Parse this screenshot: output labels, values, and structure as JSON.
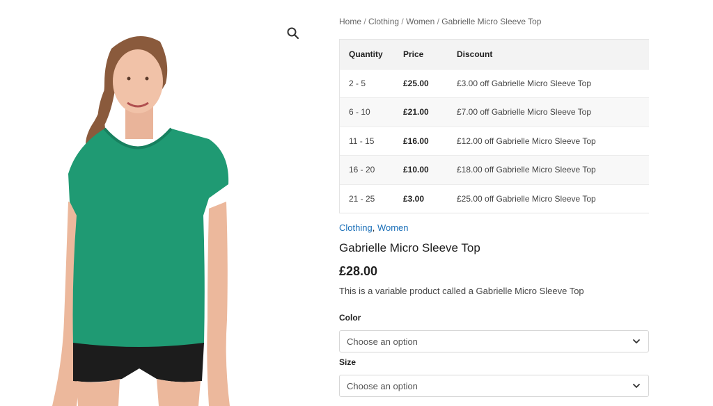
{
  "breadcrumb": {
    "items": [
      "Home",
      "Clothing",
      "Women",
      "Gabrielle Micro Sleeve Top"
    ],
    "separator": "/"
  },
  "discount_table": {
    "headers": [
      "Quantity",
      "Price",
      "Discount"
    ],
    "rows": [
      {
        "qty": "2 - 5",
        "price": "£25.00",
        "discount": "£3.00 off Gabrielle Micro Sleeve Top"
      },
      {
        "qty": "6 - 10",
        "price": "£21.00",
        "discount": "£7.00 off Gabrielle Micro Sleeve Top"
      },
      {
        "qty": "11 - 15",
        "price": "£16.00",
        "discount": "£12.00 off Gabrielle Micro Sleeve Top"
      },
      {
        "qty": "16 - 20",
        "price": "£10.00",
        "discount": "£18.00 off Gabrielle Micro Sleeve Top"
      },
      {
        "qty": "21 - 25",
        "price": "£3.00",
        "discount": "£25.00 off Gabrielle Micro Sleeve Top"
      }
    ]
  },
  "product": {
    "categories": [
      "Clothing",
      "Women"
    ],
    "category_sep": ", ",
    "title": "Gabrielle Micro Sleeve Top",
    "price": "£28.00",
    "description": "This is a variable product called a Gabrielle Micro Sleeve Top",
    "image_alt": "Woman wearing green v-neck top",
    "shirt_color": "#1f9a73"
  },
  "options": {
    "color_label": "Color",
    "color_value": "Choose an option",
    "size_label": "Size",
    "size_value": "Choose an option"
  },
  "icons": {
    "zoom": "search-icon",
    "dropdown": "chevron-down-icon"
  },
  "colors": {
    "link": "#1a6fb8",
    "table_header_bg": "#f3f3f3"
  }
}
